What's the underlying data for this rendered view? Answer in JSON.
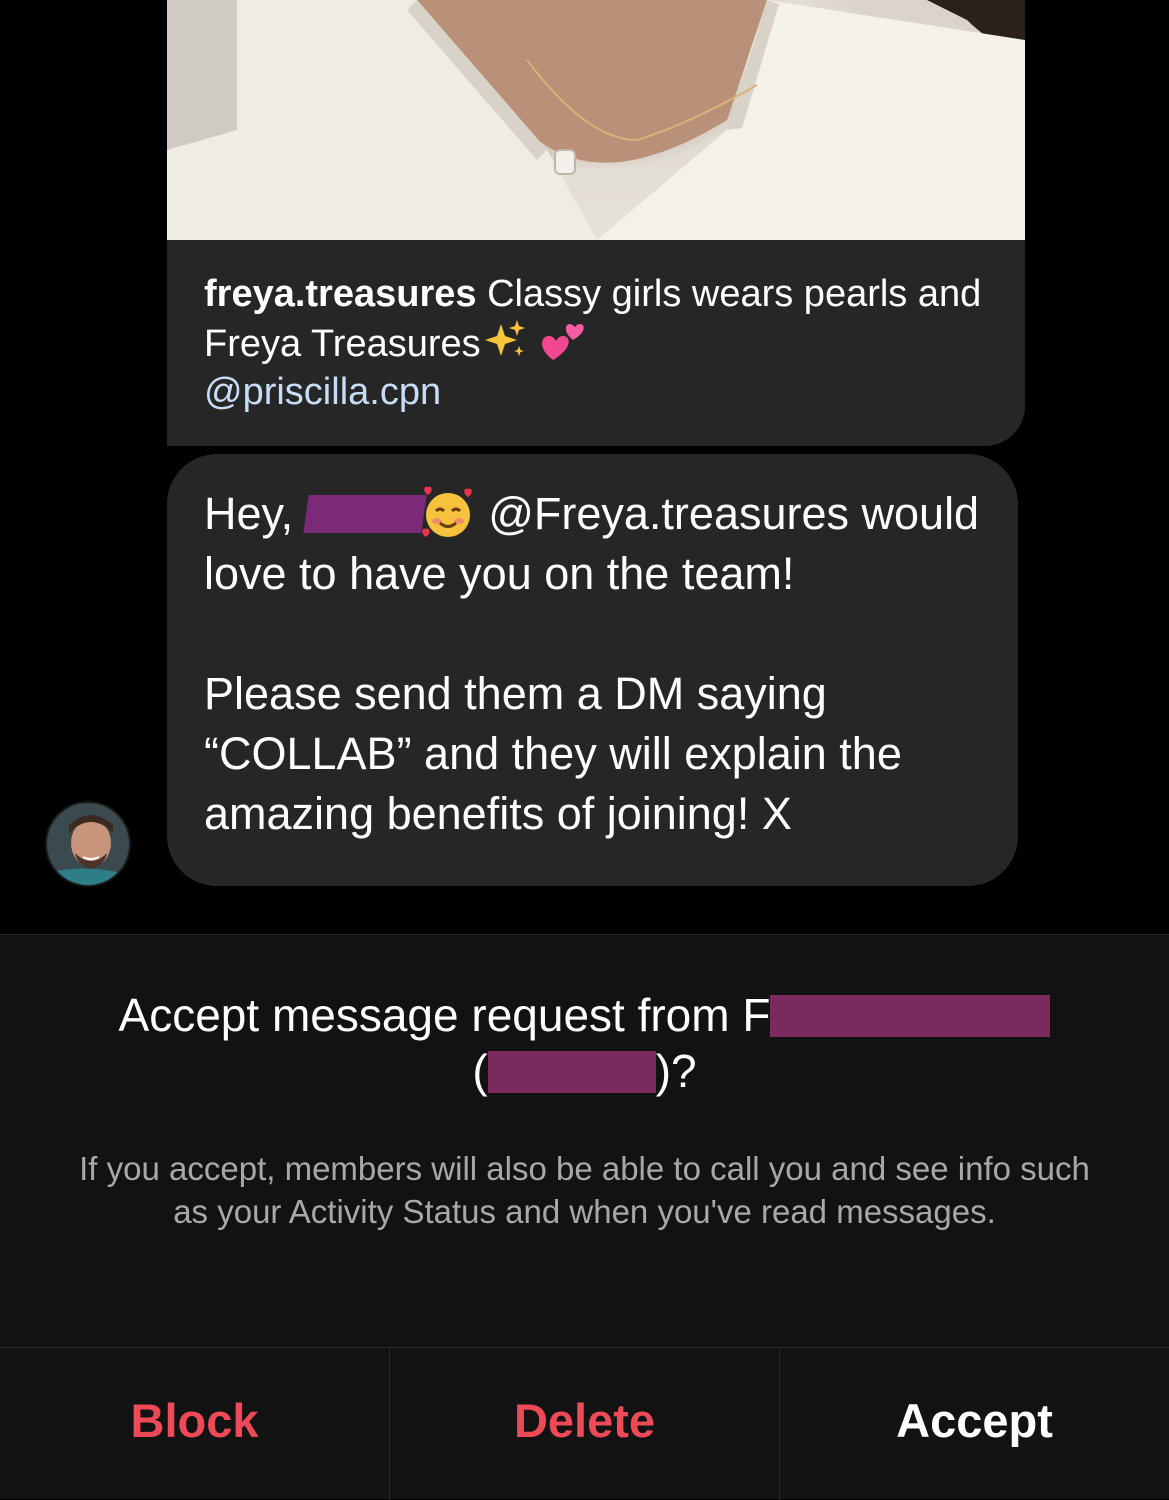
{
  "shared_post": {
    "author": "freya.treasures",
    "caption": "Classy girls wears pearls and Freya Treasures",
    "mention": "@priscilla.cpn"
  },
  "message": {
    "greeting": "Hey,",
    "line1_rest": "@Freya.treasures would love to have you on the team!",
    "paragraph2": "Please send them a DM saying “COLLAB” and they will explain the amazing benefits of joining! X"
  },
  "request": {
    "title_prefix": "Accept message request from F",
    "title_open": "(",
    "title_close": ")?",
    "description": "If you accept, members will also be able to call you and see info such as your Activity Status and when you've read messages."
  },
  "actions": {
    "block": "Block",
    "delete": "Delete",
    "accept": "Accept"
  },
  "colors": {
    "danger": "#ed4956",
    "bubble": "#262626",
    "panel": "#121212",
    "redaction": "#7a2a5c"
  }
}
